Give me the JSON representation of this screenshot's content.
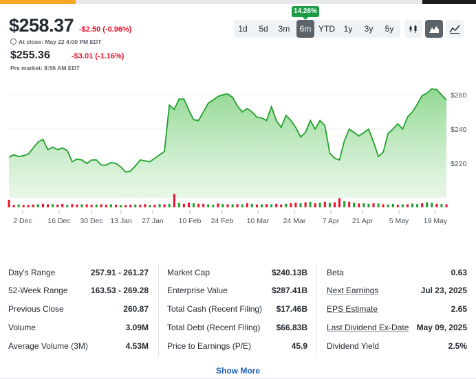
{
  "quote": {
    "price": "$258.37",
    "change": "-$2.50 (-0.96%)",
    "close_note": "At close: May 22 4:00 PM EDT",
    "pre_price": "$255.36",
    "pre_change": "-$3.01 (-1.16%)",
    "pre_note": "Pre market: 8:56 AM EDT"
  },
  "range_badge": "14.26%",
  "ranges": [
    "1d",
    "5d",
    "3m",
    "6m",
    "YTD",
    "1y",
    "3y",
    "5y"
  ],
  "active_range": "6m",
  "chart_types": [
    "candle-chart-icon",
    "mountain-chart-icon",
    "line-chart-icon"
  ],
  "chart_data": {
    "type": "area",
    "color": "#1fa02a",
    "x_tick_labels": [
      "2 Dec",
      "16 Dec",
      "30 Dec",
      "13 Jan",
      "27 Jan",
      "10 Feb",
      "24 Feb",
      "10 Mar",
      "24 Mar",
      "7 Apr",
      "21 Apr",
      "5 May",
      "19 May"
    ],
    "y_tick_labels": [
      "$260",
      "$240",
      "$220"
    ],
    "ylim": [
      200,
      268
    ],
    "price": [
      223.7,
      225.0,
      224.0,
      224.5,
      225.5,
      229.0,
      232.5,
      234.0,
      228.0,
      229.5,
      228.0,
      229.0,
      227.5,
      221.0,
      222.5,
      222.0,
      220.0,
      222.0,
      222.0,
      219.0,
      219.0,
      220.5,
      220.0,
      218.0,
      215.0,
      215.5,
      218.5,
      222.0,
      221.5,
      221.0,
      223.0,
      225.0,
      227.0,
      254.0,
      251.5,
      257.5,
      257.5,
      251.0,
      245.5,
      245.0,
      250.0,
      255.0,
      257.0,
      259.0,
      260.0,
      260.5,
      258.5,
      253.5,
      250.0,
      252.0,
      250.0,
      247.0,
      246.5,
      245.0,
      253.0,
      245.0,
      241.0,
      248.0,
      245.0,
      241.0,
      235.5,
      238.0,
      245.0,
      240.0,
      245.0,
      242.0,
      226.0,
      223.0,
      222.0,
      233.0,
      240.0,
      238.0,
      236.0,
      238.0,
      240.0,
      232.5,
      224.0,
      226.5,
      237.5,
      240.0,
      243.0,
      240.0,
      247.0,
      250.0,
      254.5,
      259.5,
      261.0,
      263.5,
      263.0,
      260.0,
      257.0
    ],
    "volume": [
      30,
      9,
      11,
      9,
      9,
      11,
      12,
      14,
      12,
      13,
      11,
      14,
      10,
      13,
      11,
      12,
      12,
      10,
      11,
      12,
      10,
      12,
      10,
      8,
      9,
      10,
      11,
      10,
      13,
      9,
      10,
      13,
      12,
      14,
      52,
      18,
      14,
      18,
      16,
      14,
      14,
      12,
      10,
      15,
      13,
      12,
      12,
      13,
      12,
      16,
      14,
      11,
      12,
      13,
      12,
      14,
      11,
      14,
      16,
      18,
      16,
      20,
      22,
      16,
      18,
      22,
      18,
      20,
      36,
      24,
      22,
      18,
      15,
      16,
      14,
      16,
      15,
      12,
      11,
      14,
      10,
      12,
      12,
      15,
      13,
      16,
      20,
      18,
      14,
      13,
      12
    ],
    "volume_down": [
      true,
      true,
      false,
      true,
      true,
      true,
      false,
      true,
      true,
      false,
      true,
      true,
      false,
      true,
      true,
      false,
      true,
      true,
      false,
      true,
      true,
      false,
      true,
      false,
      true,
      true,
      false,
      true,
      true,
      false,
      true,
      false,
      true,
      false,
      true,
      false,
      true,
      true,
      false,
      true,
      true,
      false,
      false,
      true,
      false,
      true,
      false,
      true,
      false,
      true,
      false,
      true,
      false,
      true,
      false,
      true,
      true,
      false,
      true,
      true,
      false,
      true,
      false,
      true,
      false,
      true,
      false,
      true,
      true,
      false,
      true,
      false,
      true,
      false,
      false,
      true,
      false,
      true,
      false,
      false,
      true,
      false,
      true,
      false,
      false,
      true,
      false,
      false,
      true,
      false,
      true
    ],
    "volume_max": 70
  },
  "stats": {
    "col1": [
      {
        "label": "Day's Range",
        "value": "257.91 - 261.27"
      },
      {
        "label": "52-Week Range",
        "value": "163.53 - 269.28"
      },
      {
        "label": "Previous Close",
        "value": "260.87"
      },
      {
        "label": "Volume",
        "value": "3.09M"
      },
      {
        "label": "Average Volume (3M)",
        "value": "4.53M"
      }
    ],
    "col2": [
      {
        "label": "Market Cap",
        "value": "$240.13B"
      },
      {
        "label": "Enterprise Value",
        "value": "$287.41B"
      },
      {
        "label": "Total Cash (Recent Filing)",
        "value": "$17.46B"
      },
      {
        "label": "Total Debt (Recent Filing)",
        "value": "$66.83B"
      },
      {
        "label": "Price to Earnings (P/E)",
        "value": "45.9"
      }
    ],
    "col3": [
      {
        "label": "Beta",
        "value": "0.63"
      },
      {
        "label": "Next Earnings",
        "value": "Jul 23, 2025"
      },
      {
        "label": "EPS Estimate",
        "value": "2.65"
      },
      {
        "label": "Last Dividend Ex-Date",
        "value": "May 09, 2025"
      },
      {
        "label": "Dividend Yield",
        "value": "2.5%"
      }
    ]
  },
  "show_more": "Show More"
}
